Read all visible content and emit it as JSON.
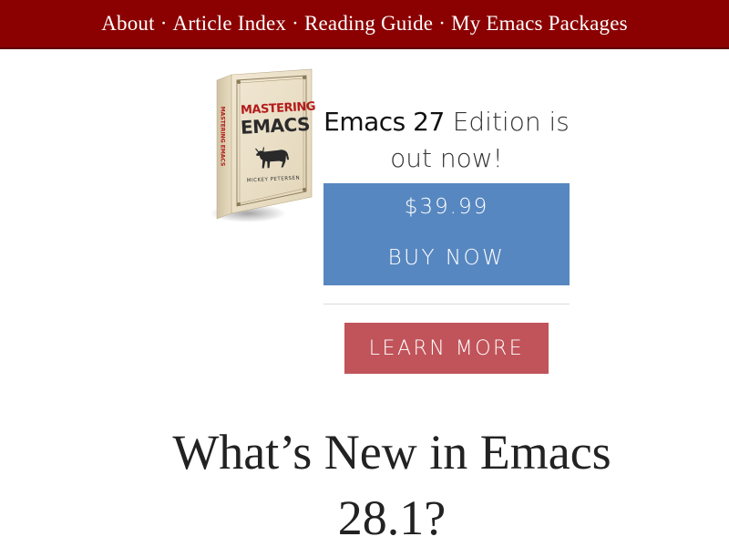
{
  "nav": {
    "items": [
      {
        "label": "About"
      },
      {
        "label": "Article Index"
      },
      {
        "label": "Reading Guide"
      },
      {
        "label": "My Emacs Packages"
      }
    ],
    "separator": "·"
  },
  "promo": {
    "book": {
      "title_line1": "MASTERING",
      "title_line2": "EMACS",
      "author": "MICKEY PETERSEN",
      "spine_text": "MASTERING EMACS"
    },
    "headline_strong": "Emacs 27",
    "headline_rest": " Edition is out now!",
    "price": "$39.99",
    "buy_label": "BUY NOW",
    "learn_more_label": "LEARN MORE"
  },
  "article": {
    "title": "What’s New in Emacs 28.1?"
  },
  "colors": {
    "topbar": "#8b0000",
    "buy_button": "#5787c0",
    "learn_more_button": "#c0545a",
    "book_title": "#b31b1b"
  }
}
